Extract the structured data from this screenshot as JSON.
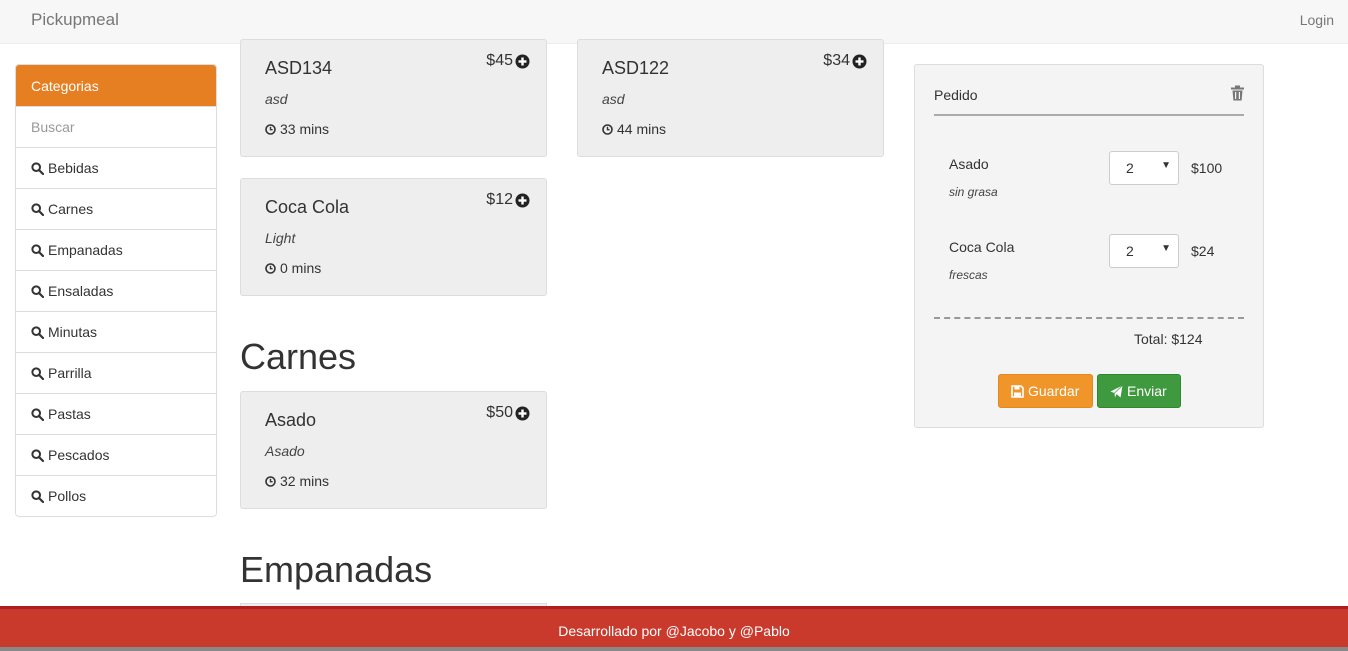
{
  "navbar": {
    "brand": "Pickupmeal",
    "login": "Login"
  },
  "sidebar": {
    "header": "Categorias",
    "search_placeholder": "Buscar",
    "items": [
      "Bebidas",
      "Carnes",
      "Empanadas",
      "Ensaladas",
      "Minutas",
      "Parrilla",
      "Pastas",
      "Pescados",
      "Pollos"
    ]
  },
  "menu": {
    "cards": [
      {
        "name": "ASD134",
        "desc": "asd",
        "time": "33 mins",
        "price": "$45"
      },
      {
        "name": "ASD122",
        "desc": "asd",
        "time": "44 mins",
        "price": "$34"
      },
      {
        "name": "Coca Cola",
        "desc": "Light",
        "time": "0 mins",
        "price": "$12"
      },
      {
        "name": "Asado",
        "desc": "Asado",
        "time": "32 mins",
        "price": "$50"
      }
    ],
    "sections": [
      "Carnes",
      "Empanadas"
    ]
  },
  "order": {
    "title": "Pedido",
    "items": [
      {
        "name": "Asado",
        "note": "sin grasa",
        "qty": "2",
        "price": "$100"
      },
      {
        "name": "Coca Cola",
        "note": "frescas",
        "qty": "2",
        "price": "$24"
      }
    ],
    "total": "Total: $124",
    "save_label": "Guardar",
    "send_label": "Enviar"
  },
  "footer": {
    "text": "Desarrollado por @Jacobo y @Pablo"
  },
  "colors": {
    "accent": "#e67e22",
    "footer": "#c9392c",
    "save": "#f0952a",
    "send": "#3f9a3f"
  }
}
